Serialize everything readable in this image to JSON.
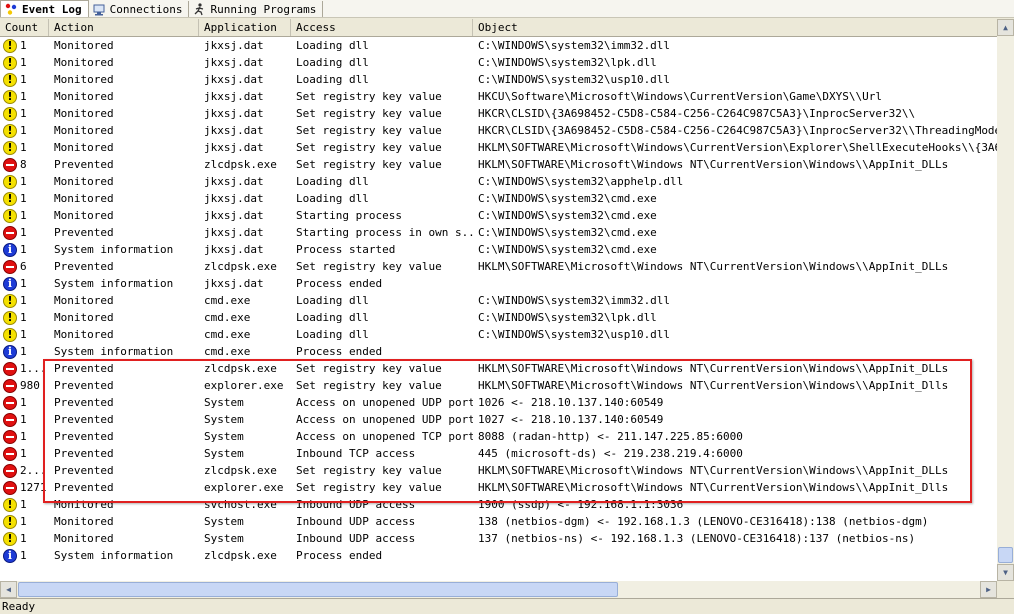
{
  "tabs": [
    {
      "label": "Event Log",
      "icon": "event-log-icon"
    },
    {
      "label": "Connections",
      "icon": "connections-icon"
    },
    {
      "label": "Running Programs",
      "icon": "running-programs-icon"
    }
  ],
  "columns": [
    "Count",
    "Action",
    "Application",
    "Access",
    "Object"
  ],
  "rows": [
    {
      "severity": "warn",
      "count": "1",
      "action": "Monitored",
      "app": "jkxsj.dat",
      "access": "Loading dll",
      "object": "C:\\WINDOWS\\system32\\imm32.dll"
    },
    {
      "severity": "warn",
      "count": "1",
      "action": "Monitored",
      "app": "jkxsj.dat",
      "access": "Loading dll",
      "object": "C:\\WINDOWS\\system32\\lpk.dll"
    },
    {
      "severity": "warn",
      "count": "1",
      "action": "Monitored",
      "app": "jkxsj.dat",
      "access": "Loading dll",
      "object": "C:\\WINDOWS\\system32\\usp10.dll"
    },
    {
      "severity": "warn",
      "count": "1",
      "action": "Monitored",
      "app": "jkxsj.dat",
      "access": "Set registry key value",
      "object": "HKCU\\Software\\Microsoft\\Windows\\CurrentVersion\\Game\\DXYS\\\\Url"
    },
    {
      "severity": "warn",
      "count": "1",
      "action": "Monitored",
      "app": "jkxsj.dat",
      "access": "Set registry key value",
      "object": "HKCR\\CLSID\\{3A698452-C5D8-C584-C256-C264C987C5A3}\\InprocServer32\\\\"
    },
    {
      "severity": "warn",
      "count": "1",
      "action": "Monitored",
      "app": "jkxsj.dat",
      "access": "Set registry key value",
      "object": "HKCR\\CLSID\\{3A698452-C5D8-C584-C256-C264C987C5A3}\\InprocServer32\\\\ThreadingModel"
    },
    {
      "severity": "warn",
      "count": "1",
      "action": "Monitored",
      "app": "jkxsj.dat",
      "access": "Set registry key value",
      "object": "HKLM\\SOFTWARE\\Microsoft\\Windows\\CurrentVersion\\Explorer\\ShellExecuteHooks\\\\{3A698452-C"
    },
    {
      "severity": "stop",
      "count": "8",
      "action": "Prevented",
      "app": "zlcdpsk.exe",
      "access": "Set registry key value",
      "object": "HKLM\\SOFTWARE\\Microsoft\\Windows NT\\CurrentVersion\\Windows\\\\AppInit_DLLs"
    },
    {
      "severity": "warn",
      "count": "1",
      "action": "Monitored",
      "app": "jkxsj.dat",
      "access": "Loading dll",
      "object": "C:\\WINDOWS\\system32\\apphelp.dll"
    },
    {
      "severity": "warn",
      "count": "1",
      "action": "Monitored",
      "app": "jkxsj.dat",
      "access": "Loading dll",
      "object": "C:\\WINDOWS\\system32\\cmd.exe"
    },
    {
      "severity": "warn",
      "count": "1",
      "action": "Monitored",
      "app": "jkxsj.dat",
      "access": "Starting process",
      "object": "C:\\WINDOWS\\system32\\cmd.exe"
    },
    {
      "severity": "stop",
      "count": "1",
      "action": "Prevented",
      "app": "jkxsj.dat",
      "access": "Starting process in own s...",
      "object": "C:\\WINDOWS\\system32\\cmd.exe"
    },
    {
      "severity": "info",
      "count": "1",
      "action": "System information",
      "app": "jkxsj.dat",
      "access": "Process started",
      "object": "C:\\WINDOWS\\system32\\cmd.exe"
    },
    {
      "severity": "stop",
      "count": "6",
      "action": "Prevented",
      "app": "zlcdpsk.exe",
      "access": "Set registry key value",
      "object": "HKLM\\SOFTWARE\\Microsoft\\Windows NT\\CurrentVersion\\Windows\\\\AppInit_DLLs"
    },
    {
      "severity": "info",
      "count": "1",
      "action": "System information",
      "app": "jkxsj.dat",
      "access": "Process ended",
      "object": ""
    },
    {
      "severity": "warn",
      "count": "1",
      "action": "Monitored",
      "app": "cmd.exe",
      "access": "Loading dll",
      "object": "C:\\WINDOWS\\system32\\imm32.dll"
    },
    {
      "severity": "warn",
      "count": "1",
      "action": "Monitored",
      "app": "cmd.exe",
      "access": "Loading dll",
      "object": "C:\\WINDOWS\\system32\\lpk.dll"
    },
    {
      "severity": "warn",
      "count": "1",
      "action": "Monitored",
      "app": "cmd.exe",
      "access": "Loading dll",
      "object": "C:\\WINDOWS\\system32\\usp10.dll"
    },
    {
      "severity": "info",
      "count": "1",
      "action": "System information",
      "app": "cmd.exe",
      "access": "Process ended",
      "object": ""
    },
    {
      "severity": "stop",
      "count": "1...",
      "action": "Prevented",
      "app": "zlcdpsk.exe",
      "access": "Set registry key value",
      "object": "HKLM\\SOFTWARE\\Microsoft\\Windows NT\\CurrentVersion\\Windows\\\\AppInit_DLLs"
    },
    {
      "severity": "stop",
      "count": "980",
      "action": "Prevented",
      "app": "explorer.exe",
      "access": "Set registry key value",
      "object": "HKLM\\SOFTWARE\\Microsoft\\Windows NT\\CurrentVersion\\Windows\\\\AppInit_Dlls"
    },
    {
      "severity": "stop",
      "count": "1",
      "action": "Prevented",
      "app": "System",
      "access": "Access on unopened UDP port",
      "object": "1026 <- 218.10.137.140:60549"
    },
    {
      "severity": "stop",
      "count": "1",
      "action": "Prevented",
      "app": "System",
      "access": "Access on unopened UDP port",
      "object": "1027 <- 218.10.137.140:60549"
    },
    {
      "severity": "stop",
      "count": "1",
      "action": "Prevented",
      "app": "System",
      "access": "Access on unopened TCP port",
      "object": "8088 (radan-http) <- 211.147.225.85:6000"
    },
    {
      "severity": "stop",
      "count": "1",
      "action": "Prevented",
      "app": "System",
      "access": "Inbound TCP access",
      "object": "445 (microsoft-ds) <- 219.238.219.4:6000"
    },
    {
      "severity": "stop",
      "count": "2...",
      "action": "Prevented",
      "app": "zlcdpsk.exe",
      "access": "Set registry key value",
      "object": "HKLM\\SOFTWARE\\Microsoft\\Windows NT\\CurrentVersion\\Windows\\\\AppInit_DLLs"
    },
    {
      "severity": "stop",
      "count": "1271",
      "action": "Prevented",
      "app": "explorer.exe",
      "access": "Set registry key value",
      "object": "HKLM\\SOFTWARE\\Microsoft\\Windows NT\\CurrentVersion\\Windows\\\\AppInit_Dlls"
    },
    {
      "severity": "warn",
      "count": "1",
      "action": "Monitored",
      "app": "svchost.exe",
      "access": "Inbound UDP access",
      "object": "1900 (ssdp) <- 192.168.1.1:3036"
    },
    {
      "severity": "warn",
      "count": "1",
      "action": "Monitored",
      "app": "System",
      "access": "Inbound UDP access",
      "object": "138 (netbios-dgm) <- 192.168.1.3 (LENOVO-CE316418):138 (netbios-dgm)"
    },
    {
      "severity": "warn",
      "count": "1",
      "action": "Monitored",
      "app": "System",
      "access": "Inbound UDP access",
      "object": "137 (netbios-ns) <- 192.168.1.3 (LENOVO-CE316418):137 (netbios-ns)"
    },
    {
      "severity": "info",
      "count": "1",
      "action": "System information",
      "app": "zlcdpsk.exe",
      "access": "Process ended",
      "object": ""
    }
  ],
  "status": "Ready",
  "colors": {
    "highlight": "#e02020",
    "warn": "#f5e100",
    "stop": "#e01010",
    "info": "#1d3bd6"
  }
}
